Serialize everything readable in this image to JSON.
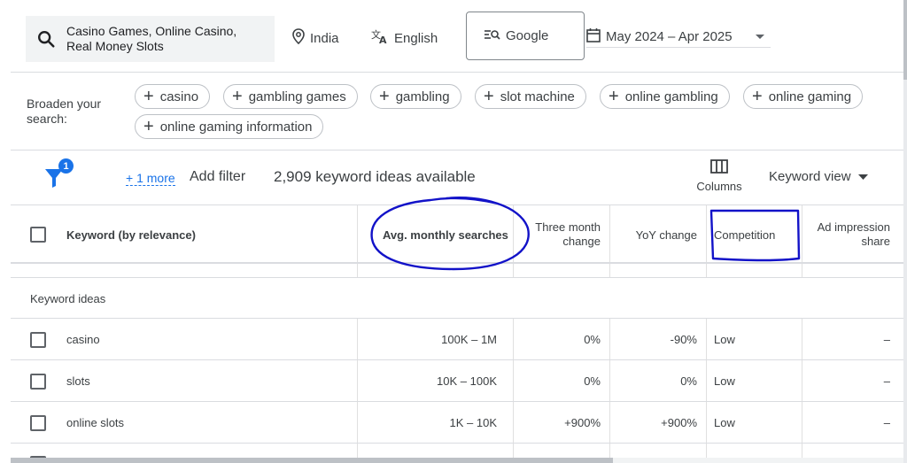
{
  "search": {
    "query": "Casino Games, Online Casino, Real Money Slots"
  },
  "filters": {
    "location": "India",
    "language": "English",
    "search_engine": "Google",
    "date_range": "May 2024 – Apr 2025"
  },
  "broaden": {
    "label": "Broaden your search:",
    "chips": [
      "casino",
      "gambling games",
      "gambling",
      "slot machine",
      "online gambling",
      "online gaming",
      "online gaming information"
    ]
  },
  "toolbar": {
    "filter_badge": "1",
    "more_link": "+ 1 more",
    "add_filter": "Add filter",
    "ideas_count": "2,909 keyword ideas available",
    "columns_label": "Columns",
    "view_label": "Keyword view"
  },
  "table": {
    "headers": {
      "keyword": "Keyword (by relevance)",
      "avg_searches": "Avg. monthly searches",
      "three_month_line1": "Three month",
      "three_month_line2": "change",
      "yoy": "YoY change",
      "competition": "Competition",
      "ad_share_line1": "Ad impression",
      "ad_share_line2": "share"
    },
    "section_title": "Keyword ideas",
    "rows": [
      {
        "keyword": "casino",
        "avg": "100K – 1M",
        "three_month": "0%",
        "yoy": "-90%",
        "competition": "Low",
        "ad_share": "–"
      },
      {
        "keyword": "slots",
        "avg": "10K – 100K",
        "three_month": "0%",
        "yoy": "0%",
        "competition": "Low",
        "ad_share": "–"
      },
      {
        "keyword": "online slots",
        "avg": "1K – 10K",
        "three_month": "+900%",
        "yoy": "+900%",
        "competition": "Low",
        "ad_share": "–"
      }
    ]
  },
  "colors": {
    "accent": "#1a73e8",
    "annotation": "#1212c8"
  }
}
